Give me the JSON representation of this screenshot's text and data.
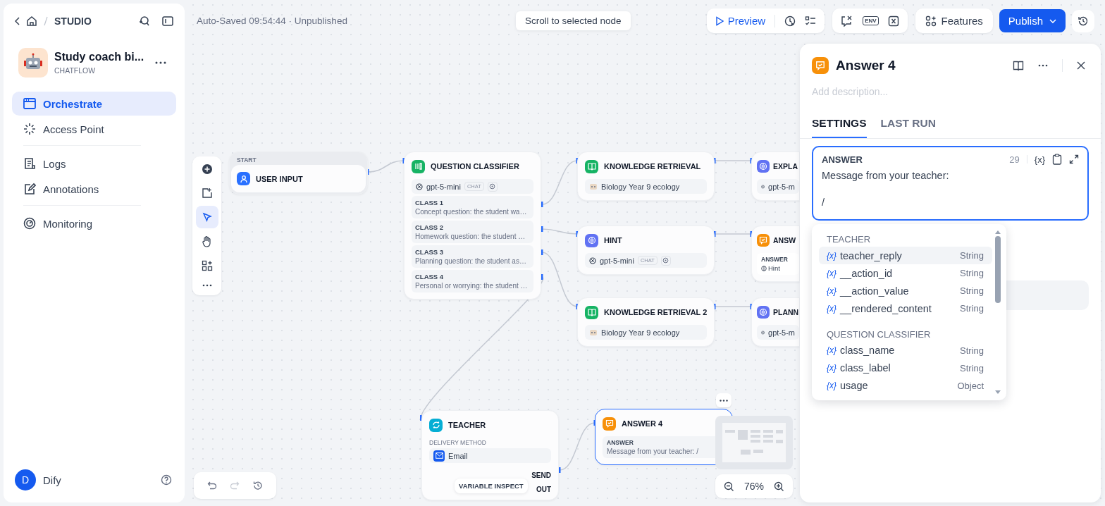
{
  "breadcrumb": {
    "section": "STUDIO"
  },
  "app": {
    "name": "Study coach bi...",
    "type": "CHATFLOW"
  },
  "nav_groups": [
    [
      {
        "label": "Orchestrate",
        "selected": true
      },
      {
        "label": "Access Point",
        "selected": false
      }
    ],
    [
      {
        "label": "Logs",
        "selected": false
      },
      {
        "label": "Annotations",
        "selected": false
      }
    ],
    [
      {
        "label": "Monitoring",
        "selected": false
      }
    ]
  ],
  "user": {
    "initial": "D",
    "name": "Dify"
  },
  "toolbar": {
    "status": "Auto-Saved 09:54:44 · Unpublished",
    "scroll_hint": "Scroll to selected node",
    "preview": "Preview",
    "env_label": "ENV",
    "features": "Features",
    "publish": "Publish"
  },
  "nodes": [
    {
      "kind": "start",
      "caption": "START",
      "title": "USER INPUT",
      "selected": false
    },
    {
      "kind": "classifier",
      "title": "QUESTION CLASSIFIER",
      "model": "gpt-5-mini",
      "badge": "CHAT",
      "selected": false,
      "classes": [
        {
          "name": "CLASS 1",
          "desc": "Concept question: the student wa…"
        },
        {
          "name": "CLASS 2",
          "desc": "Homework question: the student …"
        },
        {
          "name": "CLASS 3",
          "desc": "Planning question: the student as…"
        },
        {
          "name": "CLASS 4",
          "desc": "Personal or worrying: the student …"
        }
      ]
    },
    {
      "kind": "knowledge",
      "title": "KNOWLEDGE RETRIEVAL",
      "dataset": "Biology Year 9 ecology",
      "selected": false
    },
    {
      "kind": "llm",
      "title": "HINT",
      "model": "gpt-5-mini",
      "badge": "CHAT",
      "selected": false
    },
    {
      "kind": "knowledge",
      "title": "KNOWLEDGE RETRIEVAL 2",
      "dataset": "Biology Year 9 ecology",
      "selected": false
    },
    {
      "kind": "llm",
      "title": "EXPLA",
      "model": "gpt-5-m",
      "selected": false
    },
    {
      "kind": "answer",
      "title": "ANSW",
      "label": "ANSWER",
      "chip": "Hint",
      "selected": false
    },
    {
      "kind": "llm",
      "title": "PLANN",
      "model": "gpt-5-m",
      "selected": false
    },
    {
      "kind": "human",
      "title": "TEACHER",
      "method_label": "DELIVERY METHOD",
      "method": "Email",
      "outputs": [
        "SEND",
        "OUT"
      ],
      "selected": false
    },
    {
      "kind": "answer",
      "title": "ANSWER 4",
      "label": "ANSWER",
      "text": "Message from your teacher: /",
      "selected": true
    }
  ],
  "variable_inspect": "VARIABLE INSPECT",
  "zoom": "76%",
  "panel": {
    "title": "Answer 4",
    "description_placeholder": "Add description...",
    "tabs": [
      {
        "label": "SETTINGS",
        "selected": true
      },
      {
        "label": "LAST RUN",
        "selected": false
      }
    ],
    "editor": {
      "label": "ANSWER",
      "count": "29",
      "insert_label": "{x}",
      "lines": [
        "Message from your teacher:",
        "/"
      ]
    },
    "dropdown": {
      "groups": [
        {
          "title": "TEACHER",
          "items": [
            {
              "icon": "{x}",
              "name": "teacher_reply",
              "type": "String",
              "selected": true
            },
            {
              "icon": "{x}",
              "name": "__action_id",
              "type": "String",
              "selected": false
            },
            {
              "icon": "{x}",
              "name": "__action_value",
              "type": "String",
              "selected": false
            },
            {
              "icon": "{x}",
              "name": "__rendered_content",
              "type": "String",
              "selected": false
            }
          ]
        },
        {
          "title": "QUESTION CLASSIFIER",
          "items": [
            {
              "icon": "{x}",
              "name": "class_name",
              "type": "String",
              "selected": false
            },
            {
              "icon": "{x}",
              "name": "class_label",
              "type": "String",
              "selected": false
            },
            {
              "icon": "{x}",
              "name": "usage",
              "type": "Object",
              "selected": false
            }
          ]
        }
      ]
    }
  }
}
